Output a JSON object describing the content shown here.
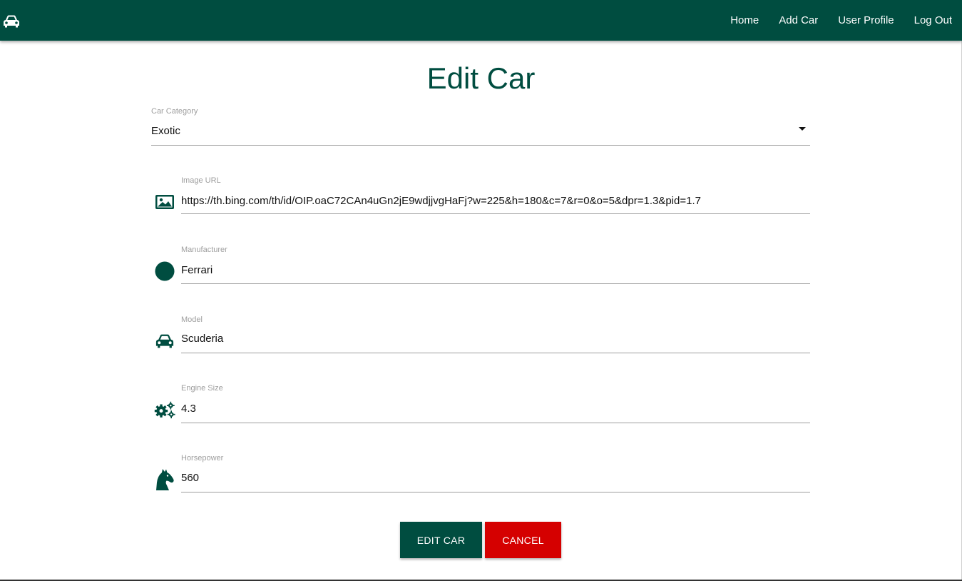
{
  "nav": {
    "brand_icon": "car-icon",
    "links": [
      "Home",
      "Add Car",
      "User Profile",
      "Log Out"
    ]
  },
  "page": {
    "title": "Edit Car"
  },
  "form": {
    "category": {
      "label": "Car Category",
      "value": "Exotic"
    },
    "image_url": {
      "label": "Image URL",
      "value": "https://th.bing.com/th/id/OIP.oaC72CAn4uGn2jE9wdjjvgHaFj?w=225&h=180&c=7&r=0&o=5&dpr=1.3&pid=1.7",
      "icon": "image-icon"
    },
    "manufacturer": {
      "label": "Manufacturer",
      "value": "Ferrari",
      "icon": "circle-icon"
    },
    "model": {
      "label": "Model",
      "value": "Scuderia",
      "icon": "car-icon"
    },
    "engine_size": {
      "label": "Engine Size",
      "value": "4.3",
      "icon": "gears-icon"
    },
    "horsepower": {
      "label": "Horsepower",
      "value": "560",
      "icon": "horse-icon"
    }
  },
  "buttons": {
    "edit": "EDIT CAR",
    "cancel": "CANCEL"
  },
  "colors": {
    "primary": "#004d40",
    "danger": "#d50000"
  }
}
